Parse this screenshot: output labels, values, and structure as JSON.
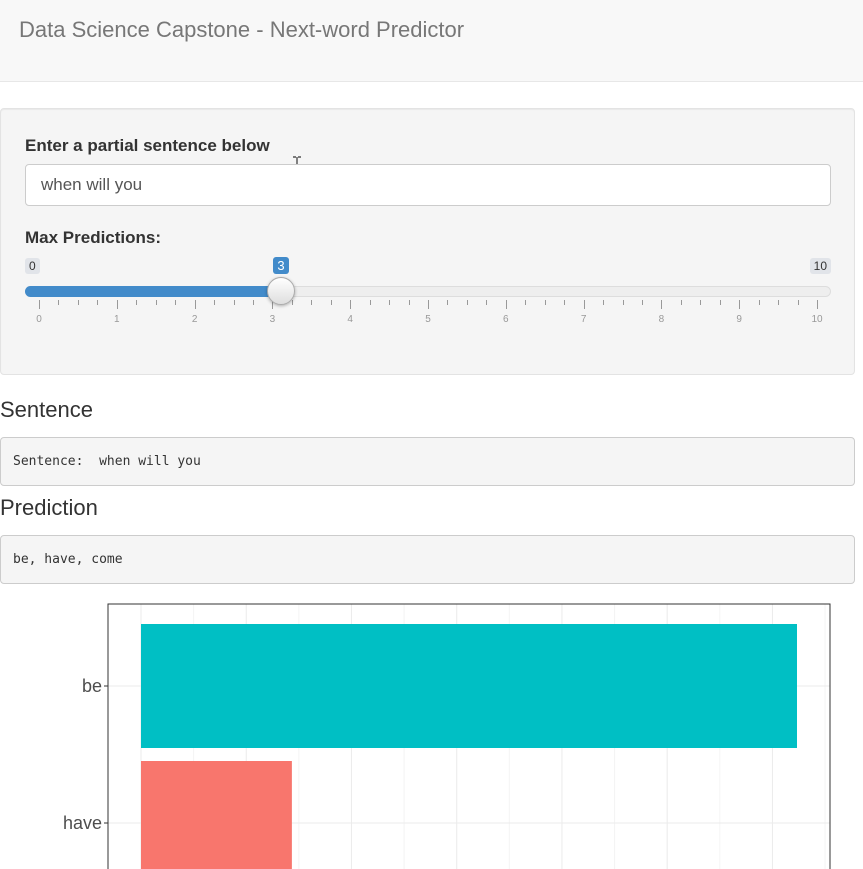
{
  "header": {
    "title": "Data Science Capstone - Next-word Predictor"
  },
  "input_panel": {
    "sentence_label": "Enter a partial sentence below",
    "sentence_value": "when will you",
    "slider": {
      "label": "Max Predictions:",
      "min": 0,
      "max": 10,
      "value": 3,
      "min_label": "0",
      "max_label": "10",
      "value_label": "3",
      "tick_labels": [
        "0",
        "1",
        "2",
        "3",
        "4",
        "5",
        "6",
        "7",
        "8",
        "9",
        "10"
      ],
      "accent_color": "#428bca"
    }
  },
  "sentence_section": {
    "heading": "Sentence",
    "output": "Sentence:  when will you"
  },
  "prediction_section": {
    "heading": "Prediction",
    "output": "be, have, come"
  },
  "chart_data": {
    "type": "bar",
    "orientation": "horizontal",
    "categories": [
      "be",
      "have"
    ],
    "values": [
      1.0,
      0.23
    ],
    "colors": [
      "#00bfc4",
      "#f8766d"
    ],
    "grid": true,
    "xlim": [
      0,
      1.05
    ]
  }
}
